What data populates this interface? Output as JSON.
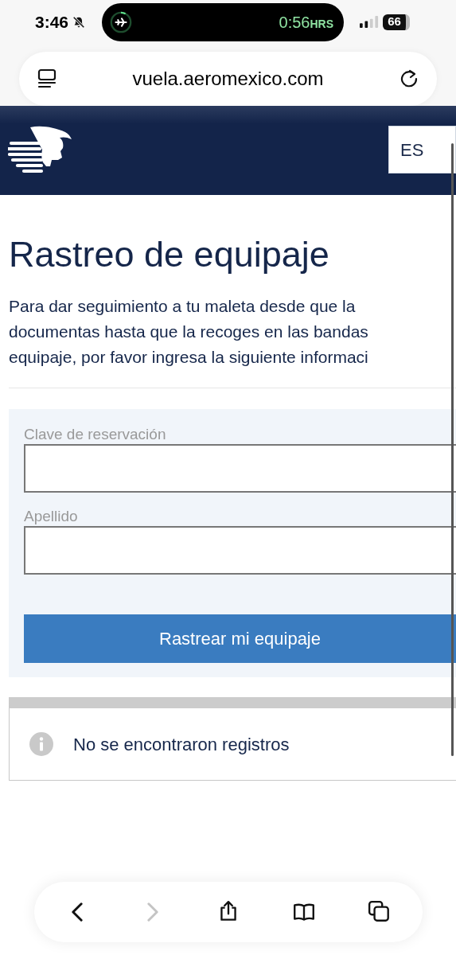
{
  "status_bar": {
    "time": "3:46",
    "muted": true,
    "activity_time": "0:56",
    "activity_unit": "HRS",
    "battery": "66"
  },
  "address_bar": {
    "url": "vuela.aeromexico.com"
  },
  "header": {
    "language": "ES"
  },
  "page": {
    "title": "Rastreo de equipaje",
    "intro_lines": [
      "Para dar seguimiento a tu maleta desde que la",
      "documentas hasta que la recoges en las bandas",
      "equipaje, por favor ingresa la siguiente informaci"
    ]
  },
  "form": {
    "fields": [
      {
        "label": "Clave de reservación"
      },
      {
        "label": "Apellido"
      }
    ],
    "submit": "Rastrear mi equipaje"
  },
  "result": {
    "message": "No se encontraron registros"
  },
  "toolbar": [
    {
      "kind": "back",
      "disabled": false
    },
    {
      "kind": "forward",
      "disabled": true
    },
    {
      "kind": "share",
      "disabled": false
    },
    {
      "kind": "bookmarks",
      "disabled": false
    },
    {
      "kind": "tabs",
      "disabled": false
    }
  ]
}
